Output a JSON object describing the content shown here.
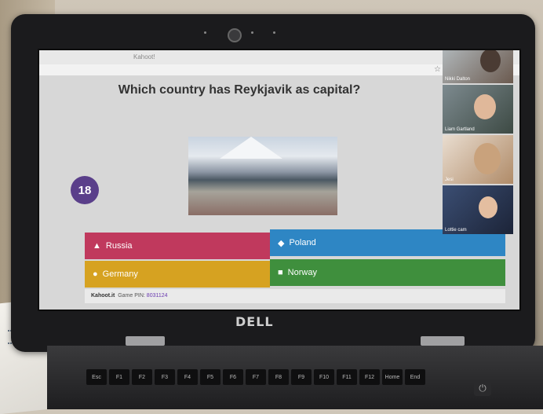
{
  "quiz": {
    "question": "Which country has Reykjavik as capital?",
    "timer": "18",
    "answers": [
      {
        "shape": "▲",
        "label": "Russia",
        "color": "#c0395d"
      },
      {
        "shape": "◆",
        "label": "Poland",
        "color": "#2e86c4"
      },
      {
        "shape": "●",
        "label": "Germany",
        "color": "#d6a221"
      },
      {
        "shape": "■",
        "label": "Norway",
        "color": "#3f8f3d"
      }
    ],
    "footer": {
      "brand": "Kahoot.it",
      "pin_label": "Game PIN:",
      "pin": "8031124"
    }
  },
  "browser": {
    "tab_text": "Kahoot!",
    "bookmark_icon": "star-icon"
  },
  "participants": [
    {
      "name": "Nikki Dalton"
    },
    {
      "name": "Liam Gartland"
    },
    {
      "name": "Jesi"
    },
    {
      "name": "Lottie cam"
    }
  ],
  "laptop": {
    "brand": "DELL"
  },
  "keyboard": [
    "Esc",
    "F1",
    "F2",
    "F3",
    "F4",
    "F5",
    "F6",
    "F7",
    "F8",
    "F9",
    "F10",
    "F11",
    "F12",
    "Home",
    "End"
  ]
}
